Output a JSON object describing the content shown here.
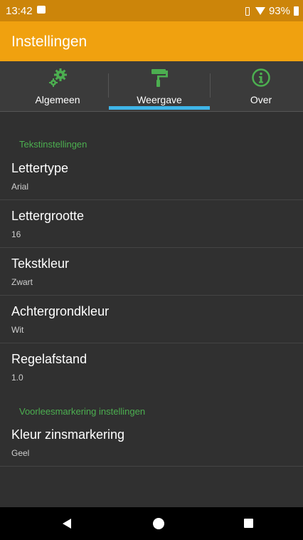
{
  "status": {
    "time": "13:42",
    "battery": "93%"
  },
  "appbar": {
    "title": "Instellingen"
  },
  "tabs": [
    {
      "label": "Algemeen",
      "icon": "gears-icon"
    },
    {
      "label": "Weergave",
      "icon": "paint-roller-icon",
      "selected": true
    },
    {
      "label": "Over",
      "icon": "info-icon"
    }
  ],
  "sections": [
    {
      "header": "Tekstinstellingen",
      "items": [
        {
          "title": "Lettertype",
          "summary": "Arial"
        },
        {
          "title": "Lettergrootte",
          "summary": "16"
        },
        {
          "title": "Tekstkleur",
          "summary": "Zwart"
        },
        {
          "title": "Achtergrondkleur",
          "summary": "Wit"
        },
        {
          "title": "Regelafstand",
          "summary": "1.0"
        }
      ]
    },
    {
      "header": "Voorleesmarkering instellingen",
      "items": [
        {
          "title": "Kleur zinsmarkering",
          "summary": "Geel"
        }
      ]
    }
  ],
  "colors": {
    "statusbar": "#cc850a",
    "appbar": "#f0a10f",
    "accent_green": "#4caf50",
    "tab_indicator": "#3fb5e8"
  }
}
